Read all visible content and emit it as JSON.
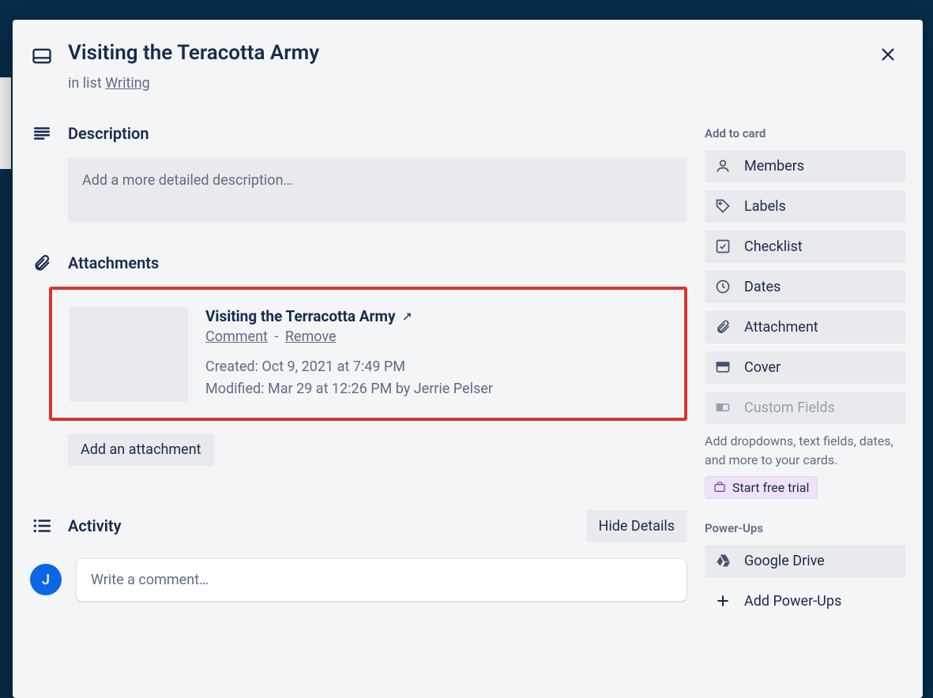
{
  "card": {
    "title": "Visiting the Teracotta Army",
    "in_list_prefix": "in list ",
    "list_name": "Writing"
  },
  "description": {
    "heading": "Description",
    "placeholder": "Add a more detailed description…"
  },
  "attachments": {
    "heading": "Attachments",
    "item": {
      "title": "Visiting the Terracotta Army",
      "comment": "Comment",
      "remove": "Remove",
      "created": "Created: Oct 9, 2021 at 7:49 PM",
      "modified": "Modified: Mar 29 at 12:26 PM by Jerrie Pelser"
    },
    "add_button": "Add an attachment"
  },
  "activity": {
    "heading": "Activity",
    "hide_button": "Hide Details",
    "avatar_initial": "J",
    "comment_placeholder": "Write a comment…"
  },
  "sidebar": {
    "add_to_card": "Add to card",
    "members": "Members",
    "labels": "Labels",
    "checklist": "Checklist",
    "dates": "Dates",
    "attachment": "Attachment",
    "cover": "Cover",
    "custom_fields": "Custom Fields",
    "custom_note": "Add dropdowns, text fields, dates, and more to your cards.",
    "start_trial": "Start free trial",
    "powerups": "Power-Ups",
    "google_drive": "Google Drive",
    "add_powerups": "Add Power-Ups"
  }
}
